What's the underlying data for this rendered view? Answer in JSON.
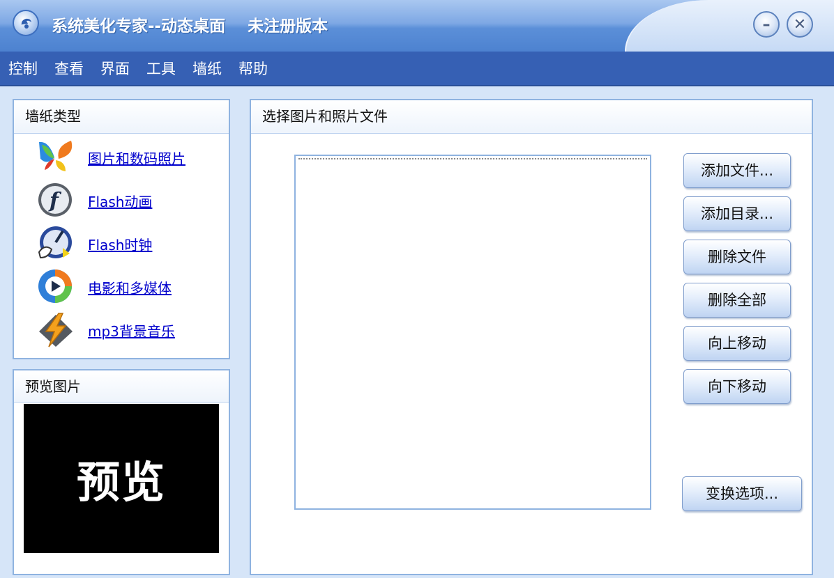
{
  "window": {
    "title": "系统美化专家--动态桌面    未注册版本",
    "minimize_label": "–",
    "close_label": "✕"
  },
  "menu": [
    "控制",
    "查看",
    "界面",
    "工具",
    "墙纸",
    "帮助"
  ],
  "wallpaper_types": {
    "title": "墙纸类型",
    "items": [
      {
        "label": "图片和数码照片",
        "icon": "butterfly-photo-icon"
      },
      {
        "label": "Flash动画",
        "icon": "flash-icon"
      },
      {
        "label": "Flash时钟",
        "icon": "flash-clock-icon"
      },
      {
        "label": "电影和多媒体",
        "icon": "media-player-icon"
      },
      {
        "label": "mp3背景音乐",
        "icon": "music-bolt-icon"
      }
    ]
  },
  "preview": {
    "title": "预览图片",
    "image_text": "预览"
  },
  "files": {
    "title": "选择图片和照片文件",
    "buttons": {
      "add_file": "添加文件...",
      "add_dir": "添加目录...",
      "delete_file": "删除文件",
      "delete_all": "删除全部",
      "move_up": "向上移动",
      "move_down": "向下移动",
      "options": "变换选项..."
    }
  },
  "colors": {
    "menu_bar": "#3660b4",
    "background": "#d6e5f8",
    "panel_border": "#8fb3e0",
    "link": "#0000cc"
  }
}
